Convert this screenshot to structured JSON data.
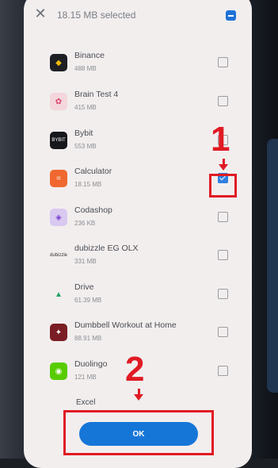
{
  "header": {
    "title": "18.15 MB selected"
  },
  "apps": [
    {
      "name": "Binance",
      "size": "488 MB",
      "icon": "binance-icon",
      "icon_bg": "#1e1f24",
      "glyph": "◆",
      "glyph_color": "#f0b90b",
      "checked": false
    },
    {
      "name": "Brain Test 4",
      "size": "415 MB",
      "icon": "brain-icon",
      "icon_bg": "#f3d7dc",
      "glyph": "✿",
      "glyph_color": "#d9426a",
      "checked": false
    },
    {
      "name": "Bybit",
      "size": "553 MB",
      "icon": "bybit-icon",
      "icon_bg": "#17181c",
      "glyph": "BYBIT",
      "glyph_color": "#ffffff",
      "checked": false
    },
    {
      "name": "Calculator",
      "size": "18.15 MB",
      "icon": "calculator-icon",
      "icon_bg": "#f0682f",
      "glyph": "=",
      "glyph_color": "#ffffff",
      "checked": true
    },
    {
      "name": "Codashop",
      "size": "236 KB",
      "icon": "codashop-icon",
      "icon_bg": "#d9c9f0",
      "glyph": "◈",
      "glyph_color": "#7b3fd0",
      "checked": false
    },
    {
      "name": "dubizzle EG OLX",
      "size": "331 MB",
      "icon": "dubizzle-icon",
      "icon_bg": "#f2eeee",
      "glyph": "dubizzle",
      "glyph_color": "#333333",
      "checked": false
    },
    {
      "name": "Drive",
      "size": "61.39 MB",
      "icon": "drive-icon",
      "icon_bg": "#f2eeee",
      "glyph": "▲",
      "glyph_color": "#1fa463",
      "checked": false
    },
    {
      "name": "Dumbbell Workout at Home",
      "size": "88.91 MB",
      "icon": "dumbbell-icon",
      "icon_bg": "#7a1d24",
      "glyph": "✦",
      "glyph_color": "#ffffff",
      "checked": false
    },
    {
      "name": "Duolingo",
      "size": "121 MB",
      "icon": "duolingo-icon",
      "icon_bg": "#58cc02",
      "glyph": "◉",
      "glyph_color": "#ffffff",
      "checked": false
    }
  ],
  "peek_name": "Excel",
  "ok_label": "OK",
  "annotations": {
    "first": "1",
    "second": "2"
  }
}
